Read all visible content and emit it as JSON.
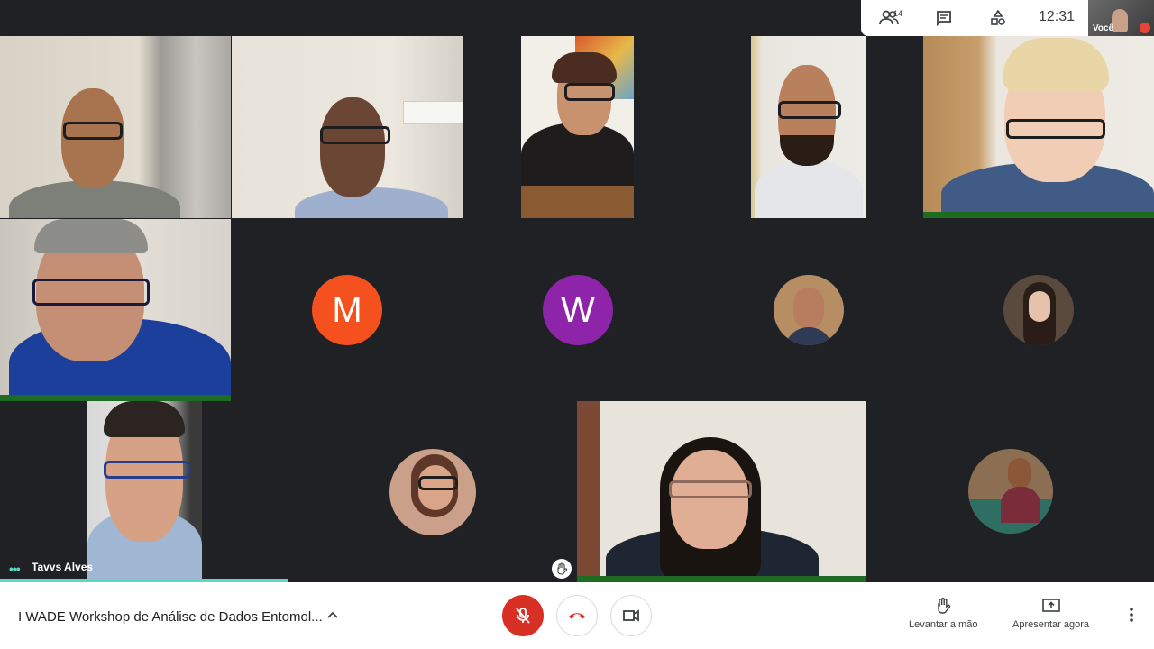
{
  "top_panel": {
    "people_count": "14",
    "time": "12:31",
    "self_label": "Você"
  },
  "tiles": {
    "speaker_name": "Tavvs Alves"
  },
  "avatars": {
    "m_initial": "M",
    "w_initial": "W",
    "m_color": "#f4511e",
    "w_color": "#8e24aa"
  },
  "bottom_bar": {
    "meeting_title": "I WADE Workshop de Análise de Dados Entomol...",
    "raise_hand_label": "Levantar a mão",
    "present_label": "Apresentar agora"
  },
  "colors": {
    "speaking_border": "#1e6b22",
    "teal": "#5bd7c6",
    "mic_off_red": "#d93025"
  }
}
